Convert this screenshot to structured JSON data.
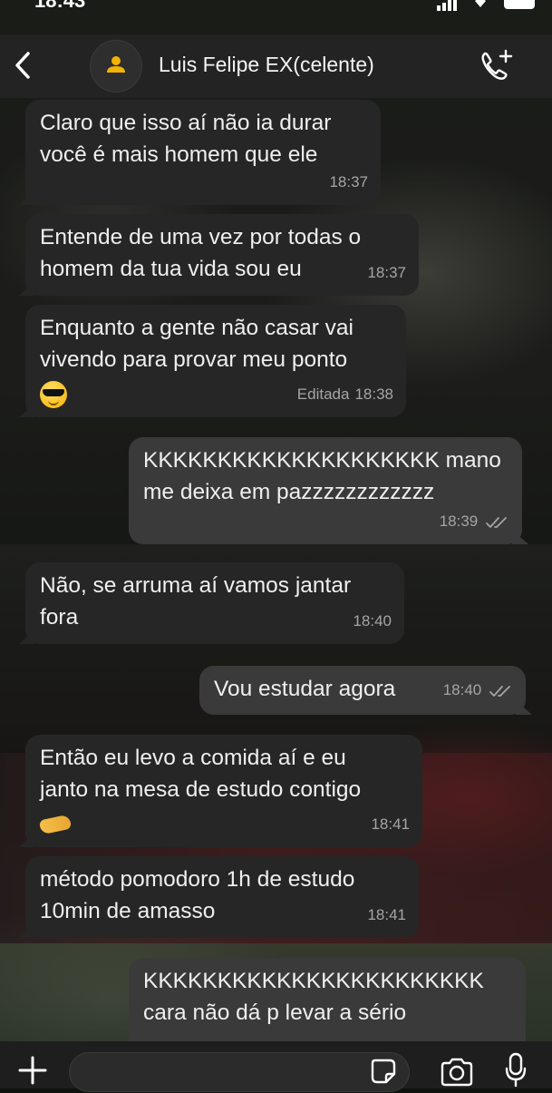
{
  "status_bar": {
    "time": "18:43"
  },
  "header": {
    "contact_name": "Luis Felipe EX(celente)"
  },
  "messages": [
    {
      "direction": "in",
      "lines": [
        "Claro que isso aí não ia durar",
        "você é mais homem que ele"
      ],
      "time": "18:37"
    },
    {
      "direction": "in",
      "lines": [
        "Entende de uma vez por todas o",
        "homem da tua vida sou eu"
      ],
      "time": "18:37"
    },
    {
      "direction": "in",
      "lines": [
        "Enquanto a gente não casar vai",
        "vivendo para provar meu ponto"
      ],
      "emoji": "smiling-face-with-sunglasses",
      "edited": "Editada",
      "time": "18:38"
    },
    {
      "direction": "out",
      "lines": [
        "KKKKKKKKKKKKKKKKKKKK mano",
        "me deixa em pazzzzzzzzzzzz"
      ],
      "time": "18:39",
      "status": "read"
    },
    {
      "direction": "in",
      "lines": [
        "Não, se arruma aí vamos jantar",
        "fora"
      ],
      "time": "18:40"
    },
    {
      "direction": "out",
      "lines": [
        "Vou estudar agora"
      ],
      "time": "18:40",
      "status": "read"
    },
    {
      "direction": "in",
      "lines": [
        "Então eu levo a comida aí e eu",
        "janto na mesa de estudo contigo"
      ],
      "emoji": "handshake",
      "time": "18:41"
    },
    {
      "direction": "in",
      "lines": [
        "método pomodoro 1h de estudo",
        "10min de amasso"
      ],
      "time": "18:41"
    },
    {
      "direction": "out",
      "lines": [
        "KKKKKKKKKKKKKKKKKKKKKKK",
        "cara não dá p levar a sério"
      ],
      "time": "",
      "status": "read"
    }
  ],
  "input": {
    "value": "",
    "placeholder": ""
  },
  "icons": {
    "back": "chevron-left-icon",
    "avatar": "person-icon",
    "call": "phone-plus-icon",
    "plus": "plus-icon",
    "sticker": "sticker-icon",
    "camera": "camera-icon",
    "mic": "microphone-icon"
  },
  "colors": {
    "incoming_bubble": "#262626",
    "outgoing_bubble": "#3a3a3a",
    "header_bg": "#232323",
    "avatar_icon": "#f2b400"
  }
}
